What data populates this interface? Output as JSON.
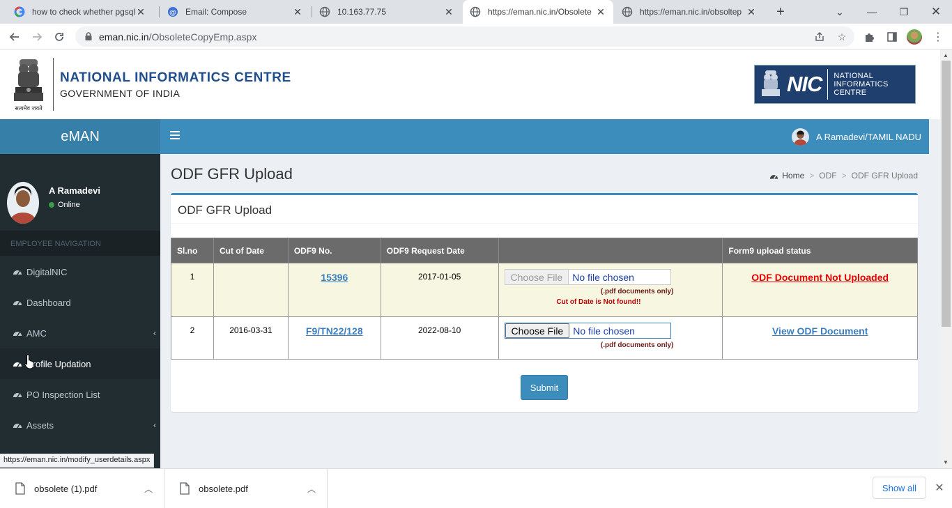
{
  "browser": {
    "tabs": [
      {
        "title": "how to check whether pgsql",
        "icon": "google-icon"
      },
      {
        "title": "Email: Compose",
        "icon": "email-icon"
      },
      {
        "title": "10.163.77.75",
        "icon": "globe-icon"
      },
      {
        "title": "https://eman.nic.in/Obsolete",
        "icon": "globe-icon"
      },
      {
        "title": "https://eman.nic.in/obsoltep",
        "icon": "globe-icon"
      }
    ],
    "url_host": "eman.nic.in",
    "url_path": "/ObsoleteCopyEmp.aspx",
    "status_url": "https://eman.nic.in/modify_userdetails.aspx"
  },
  "header": {
    "org_name": "NATIONAL INFORMATICS CENTRE",
    "gov_name": "GOVERNMENT OF INDIA",
    "emblem_caption": "सत्यमेव जयते",
    "logo_text": "NIC",
    "logo_sub": [
      "NATIONAL",
      "INFORMATICS",
      "CENTRE"
    ]
  },
  "appbar": {
    "brand": "eMAN",
    "user_label": "A Ramadevi/TAMIL NADU"
  },
  "sidebar": {
    "user_name": "A Ramadevi",
    "user_status": "Online",
    "nav_header": "EMPLOYEE NAVIGATION",
    "items": [
      {
        "label": "DigitalNIC",
        "has_submenu": false
      },
      {
        "label": "Dashboard",
        "has_submenu": false
      },
      {
        "label": "AMC",
        "has_submenu": true
      },
      {
        "label": "Profile Updation",
        "has_submenu": false
      },
      {
        "label": "PO Inspection List",
        "has_submenu": false
      },
      {
        "label": "Assets",
        "has_submenu": true
      }
    ]
  },
  "content": {
    "page_title": "ODF GFR Upload",
    "breadcrumb": [
      "Home",
      "ODF",
      "ODF GFR Upload"
    ],
    "box_title": "ODF GFR Upload",
    "table": {
      "headers": [
        "Sl.no",
        "Cut of Date",
        "ODF9 No.",
        "ODF9 Request Date",
        "",
        "Form9 upload status"
      ],
      "rows": [
        {
          "slno": "1",
          "cut_date": "",
          "odf9_no": "15396",
          "request_date": "2017-01-05",
          "file_button": "Choose File",
          "file_text": "No file chosen",
          "note": "(.pdf documents only)",
          "error": "Cut of Date is Not found!!",
          "status": "ODF Document Not Uploaded"
        },
        {
          "slno": "2",
          "cut_date": "2016-03-31",
          "odf9_no": "F9/TN22/128",
          "request_date": "2022-08-10",
          "file_button": "Choose File",
          "file_text": "No file chosen",
          "note": "(.pdf documents only)",
          "error": "",
          "status": "View ODF Document"
        }
      ]
    },
    "submit_label": "Submit"
  },
  "downloads": {
    "items": [
      "obsolete (1).pdf",
      "obsolete.pdf"
    ],
    "show_all": "Show all"
  },
  "colors": {
    "appbar": "#3c8dbc",
    "brand": "#367fa9",
    "sidebar": "#222d32",
    "error_red": "#e00000",
    "link_blue": "#3c7fbf"
  }
}
